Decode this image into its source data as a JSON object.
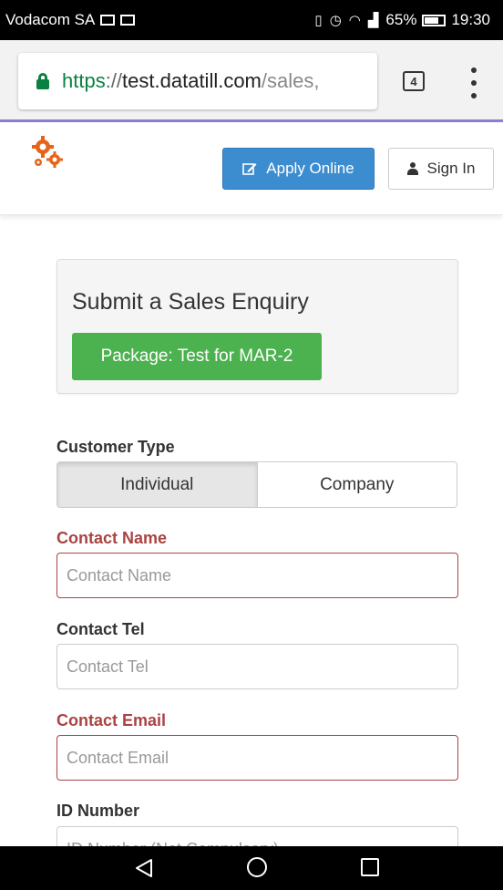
{
  "status_bar": {
    "carrier": "Vodacom SA",
    "battery_percent": "65%",
    "time": "19:30",
    "icons": [
      "screen-icon",
      "gallery-icon",
      "vibrate-icon",
      "alarm-icon",
      "wifi-icon",
      "signal-icon",
      "battery-icon"
    ]
  },
  "browser": {
    "url_scheme": "https",
    "url_separator": "://",
    "url_host": "test.datatill.com",
    "url_path": "/sales,",
    "tab_count": "4"
  },
  "header": {
    "apply_label": "Apply Online",
    "signin_label": "Sign In",
    "logo_color": "#e8631a"
  },
  "panel": {
    "title": "Submit a Sales Enquiry",
    "package_label": "Package: Test for MAR-2"
  },
  "form": {
    "customer_type": {
      "label": "Customer Type",
      "options": [
        "Individual",
        "Company"
      ],
      "selected": "Individual"
    },
    "contact_name": {
      "label": "Contact Name",
      "placeholder": "Contact Name",
      "value": ""
    },
    "contact_tel": {
      "label": "Contact Tel",
      "placeholder": "Contact Tel",
      "value": ""
    },
    "contact_email": {
      "label": "Contact Email",
      "placeholder": "Contact Email",
      "value": ""
    },
    "id_number": {
      "label": "ID Number",
      "placeholder": "ID Number (Not Compulsory)"
    }
  },
  "colors": {
    "primary": "#3c8dd0",
    "success": "#4cb14f",
    "error": "#a94442",
    "secure": "#0b8043"
  }
}
